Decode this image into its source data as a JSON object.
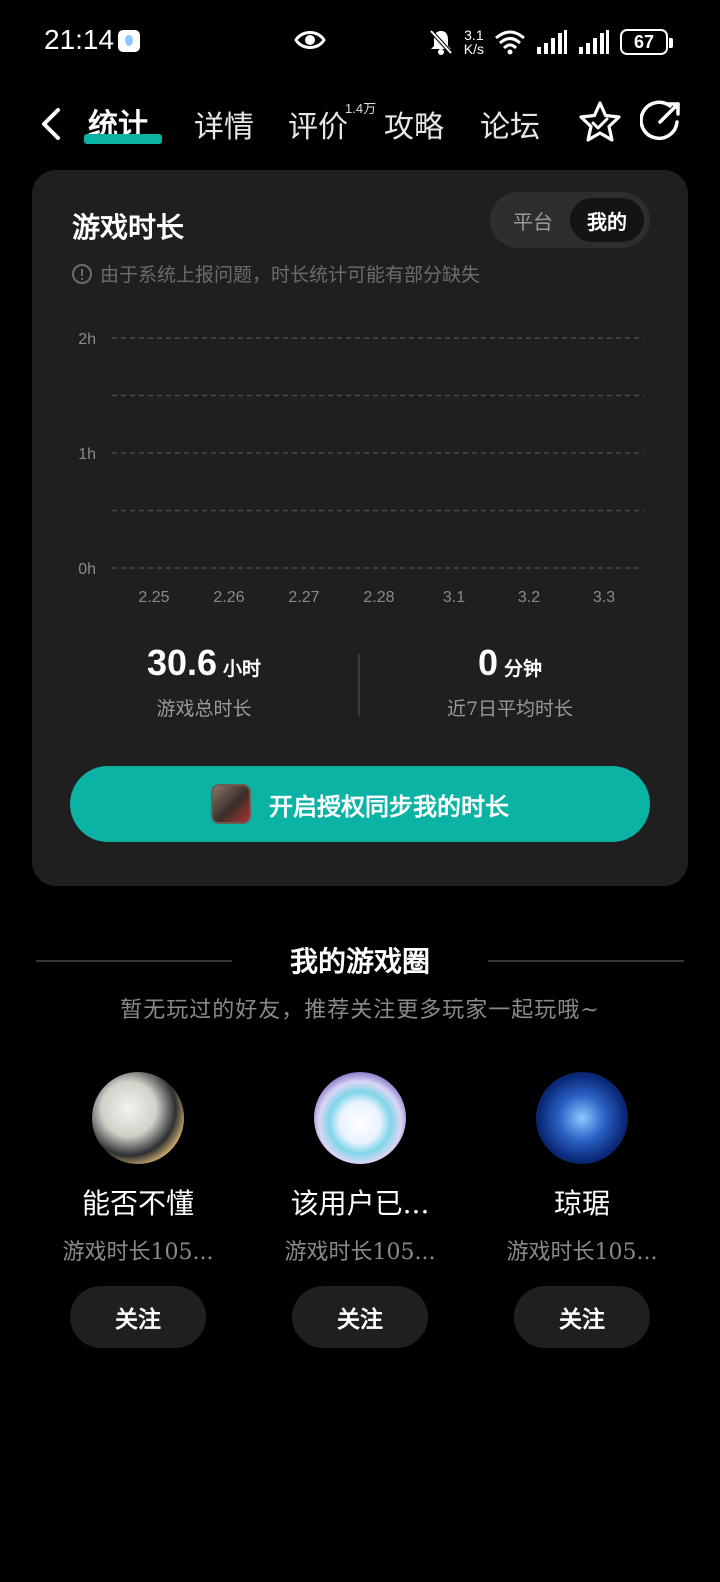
{
  "status_bar": {
    "time": "21:14",
    "net_speed_value": "3.1",
    "net_speed_unit": "K/s",
    "battery": "67",
    "icons": [
      "app-notification-icon",
      "eye-icon",
      "mute-icon",
      "wifi-icon",
      "signal-icon",
      "signal-icon",
      "battery-icon"
    ]
  },
  "nav": {
    "tabs": [
      {
        "label": "统计",
        "active": true
      },
      {
        "label": "详情",
        "active": false
      },
      {
        "label": "评价",
        "active": false
      },
      {
        "label": "攻略",
        "active": false
      },
      {
        "label": "论坛",
        "active": false
      }
    ],
    "review_count_badge": "1.4万",
    "icons": [
      "back-icon",
      "star-icon",
      "share-icon"
    ]
  },
  "stats": {
    "title": "游戏时长",
    "toggle": {
      "platform": "平台",
      "mine": "我的",
      "selected": "mine"
    },
    "notice": "由于系统上报问题，时长统计可能有部分缺失",
    "total": {
      "value": "30.6",
      "unit": "小时",
      "label": "游戏总时长"
    },
    "avg": {
      "value": "0",
      "unit": "分钟",
      "label": "近7日平均时长"
    },
    "sync_button": "开启授权同步我的时长"
  },
  "chart_data": {
    "type": "bar",
    "categories": [
      "2.25",
      "2.26",
      "2.27",
      "2.28",
      "3.1",
      "3.2",
      "3.3"
    ],
    "values": [
      0,
      0,
      0,
      0,
      0,
      0,
      0
    ],
    "yticks": [
      "0h",
      "1h",
      "2h"
    ],
    "ylim": [
      0,
      2
    ],
    "grid": true,
    "colors": {
      "grid": "#4a4a4a",
      "tick": "#8a8a8a"
    }
  },
  "game_circle": {
    "title": "我的游戏圈",
    "subtitle": "暂无玩过的好友，推荐关注更多玩家一起玩哦~",
    "friends": [
      {
        "name": "能否不懂",
        "desc": "游戏时长105...",
        "follow": "关注"
      },
      {
        "name": "该用户已...",
        "desc": "游戏时长105...",
        "follow": "关注"
      },
      {
        "name": "琼琚",
        "desc": "游戏时长105...",
        "follow": "关注"
      }
    ]
  },
  "colors": {
    "accent": "#0bb3a5",
    "card": "#1f1f1f",
    "background": "#000000"
  }
}
